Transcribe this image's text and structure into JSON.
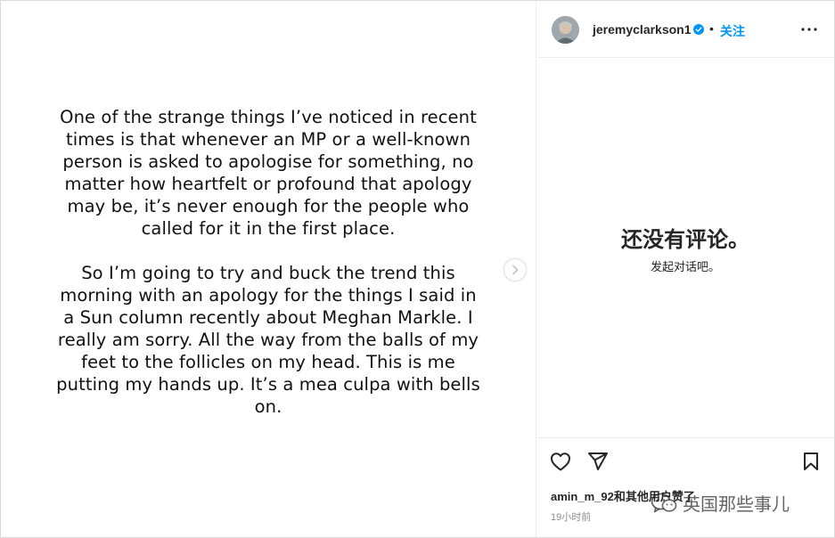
{
  "post": {
    "paragraph_1": "One of the strange things I’ve noticed in recent times is that whenever an MP or a well-known person is asked to apologise for something, no matter how heartfelt or profound that apology may be, it’s never enough for the people who called for it in the first place.",
    "paragraph_2": "So I’m going to try and buck the trend this morning with an apology for the things I said in a Sun column recently about Meghan Markle. I really am sorry. All the way from the balls of my feet to the follicles on my head. This is me putting my hands up. It’s a mea culpa with bells on."
  },
  "header": {
    "username": "jeremyclarkson1",
    "separator": "•",
    "follow_label": "关注"
  },
  "comments": {
    "empty_title": "还没有评论。",
    "empty_subtitle": "发起对话吧。"
  },
  "footer": {
    "likes_text": "amin_m_92和其他用户赞了",
    "timestamp": "19小时前"
  },
  "watermark": {
    "text": "英国那些事儿"
  },
  "icons": {
    "next": "chevron-right-icon",
    "verified": "verified-badge-icon",
    "more": "more-options-icon",
    "like": "heart-icon",
    "share": "paper-plane-icon",
    "save": "bookmark-icon"
  },
  "colors": {
    "accent": "#0095f6",
    "text": "#262626",
    "muted": "#8e8e8e"
  }
}
